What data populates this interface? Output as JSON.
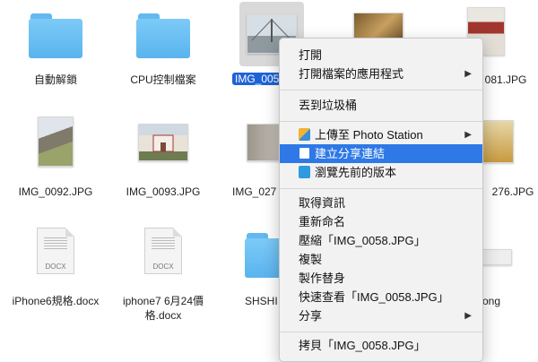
{
  "files": [
    {
      "name": "自動解鎖",
      "type": "folder"
    },
    {
      "name": "CPU控制檔案",
      "type": "folder"
    },
    {
      "name": "IMG_0058.JPG",
      "type": "photo",
      "visible_label": "IMG_005",
      "selected": true
    },
    {
      "name": "",
      "type": "photo"
    },
    {
      "name": "",
      "type": "photo",
      "visible_label": "081.JPG"
    },
    {
      "name": "IMG_0092.JPG",
      "type": "photo"
    },
    {
      "name": "IMG_0093.JPG",
      "type": "photo"
    },
    {
      "name": "",
      "type": "photo",
      "visible_label": "IMG_027"
    },
    {
      "name": "",
      "type": "photo",
      "visible_label": "276.JPG"
    },
    {
      "name": "iPhone6規格.docx",
      "type": "doc",
      "ext": "DOCX"
    },
    {
      "name": "iphone7 6月24價格.docx",
      "type": "doc",
      "ext": "DOCX"
    },
    {
      "name": "",
      "type": "folder",
      "visible_label": "SHSHI"
    },
    {
      "name": "",
      "type": "image",
      "visible_label": "ong"
    }
  ],
  "context_menu": {
    "items": [
      {
        "label": "打開"
      },
      {
        "label": "打開檔案的應用程式",
        "submenu": true
      },
      {
        "separator": true
      },
      {
        "label": "丟到垃圾桶"
      },
      {
        "separator": true
      },
      {
        "label": "上傳至 Photo Station",
        "submenu": true,
        "icon": "photo-station-icon"
      },
      {
        "label": "建立分享連結",
        "highlighted": true,
        "icon": "share-link-icon"
      },
      {
        "label": "瀏覽先前的版本",
        "icon": "previous-version-icon"
      },
      {
        "separator": true
      },
      {
        "label": "取得資訊"
      },
      {
        "label": "重新命名"
      },
      {
        "label": "壓縮「IMG_0058.JPG」"
      },
      {
        "label": "複製"
      },
      {
        "label": "製作替身"
      },
      {
        "label": "快速查看「IMG_0058.JPG」"
      },
      {
        "label": "分享",
        "submenu": true
      },
      {
        "separator": true
      },
      {
        "label": "拷貝「IMG_0058.JPG」"
      }
    ],
    "arrow_glyph": "▶",
    "highlight_color": "#2e79e6"
  }
}
